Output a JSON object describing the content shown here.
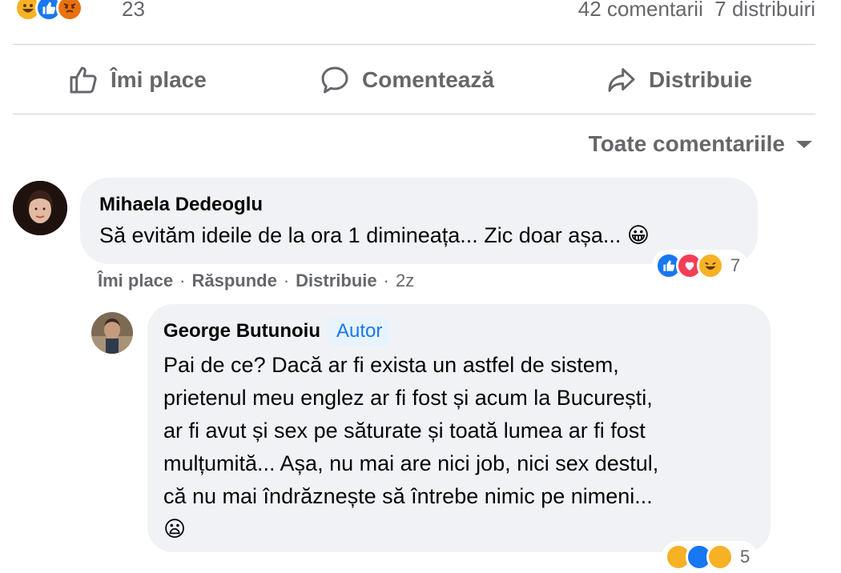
{
  "summary": {
    "reactions_count": "23",
    "stats_text": "42 comentarii  7 distribuiri",
    "reaction_icons": [
      "haha",
      "like",
      "angry"
    ]
  },
  "actions": {
    "like_label": "Îmi place",
    "comment_label": "Comentează",
    "share_label": "Distribuie"
  },
  "sort": {
    "label": "Toate comentariile"
  },
  "comments": [
    {
      "author": "Mihaela Dedeoglu",
      "text": "Să evităm ideile de la ora 1 dimineața... Zic doar așa... 😀",
      "like": "Îmi place",
      "reply": "Răspunde",
      "share": "Distribuie",
      "time": "2z",
      "reactions_count": "7",
      "reaction_icons": [
        "like",
        "love",
        "haha"
      ]
    },
    {
      "author": "George Butunoiu",
      "badge": "Autor",
      "lines": [
        "Pai de ce? Dacă ar fi exista un astfel de sistem,",
        "prietenul meu englez ar fi fost și acum la București,",
        "ar fi avut și sex pe săturate și toată lumea ar fi fost",
        "mulțumită... Așa, nu mai are nici job, nici sex destul,",
        "că nu mai îndrăznește să întrebe nimic pe nimeni...",
        "😦"
      ],
      "reactions_count": "5",
      "reaction_icons": [
        "haha",
        "like",
        "wow"
      ]
    }
  ],
  "colors": {
    "accent": "#1877f2",
    "muted": "#65676b",
    "bubble": "#f0f2f5"
  }
}
